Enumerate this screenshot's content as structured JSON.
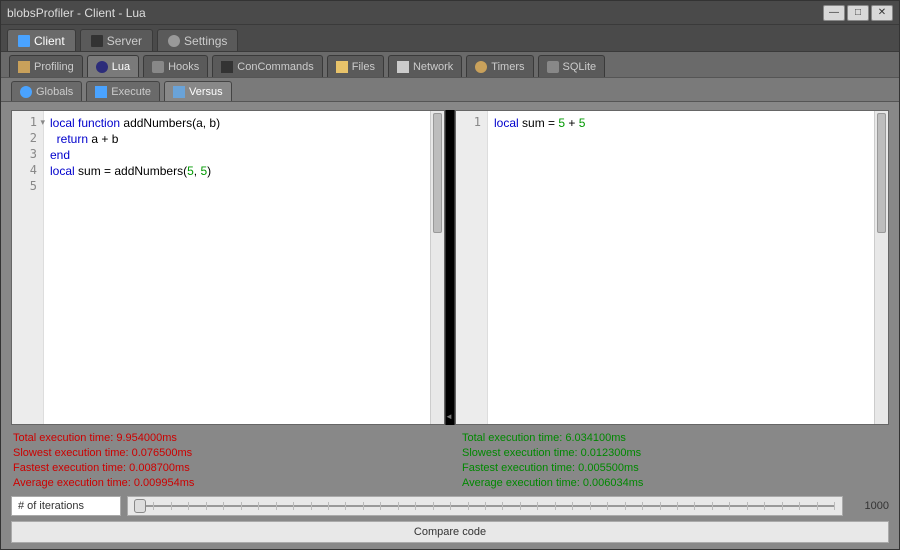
{
  "window": {
    "title": "blobsProfiler - Client - Lua"
  },
  "main_tabs": [
    {
      "label": "Client",
      "active": true
    },
    {
      "label": "Server",
      "active": false
    },
    {
      "label": "Settings",
      "active": false
    }
  ],
  "sub_tabs": [
    {
      "label": "Profiling",
      "active": false
    },
    {
      "label": "Lua",
      "active": true
    },
    {
      "label": "Hooks",
      "active": false
    },
    {
      "label": "ConCommands",
      "active": false
    },
    {
      "label": "Files",
      "active": false
    },
    {
      "label": "Network",
      "active": false
    },
    {
      "label": "Timers",
      "active": false
    },
    {
      "label": "SQLite",
      "active": false
    }
  ],
  "tert_tabs": [
    {
      "label": "Globals",
      "active": false
    },
    {
      "label": "Execute",
      "active": false
    },
    {
      "label": "Versus",
      "active": true
    }
  ],
  "left_code": {
    "lines": [
      "1",
      "2",
      "3",
      "4",
      "5"
    ],
    "tokens": [
      [
        {
          "t": "local",
          "c": "kw"
        },
        {
          "t": " "
        },
        {
          "t": "function",
          "c": "kw"
        },
        {
          "t": " addNumbers(a, b)"
        }
      ],
      [
        {
          "t": "  "
        },
        {
          "t": "return",
          "c": "kw"
        },
        {
          "t": " a + b"
        }
      ],
      [
        {
          "t": "end",
          "c": "kw"
        }
      ],
      [
        {
          "t": ""
        }
      ],
      [
        {
          "t": "local",
          "c": "kw"
        },
        {
          "t": " sum = addNumbers("
        },
        {
          "t": "5",
          "c": "num"
        },
        {
          "t": ", "
        },
        {
          "t": "5",
          "c": "num"
        },
        {
          "t": ")"
        }
      ]
    ]
  },
  "right_code": {
    "lines": [
      "1"
    ],
    "tokens": [
      [
        {
          "t": "local",
          "c": "kw"
        },
        {
          "t": " sum = "
        },
        {
          "t": "5",
          "c": "num"
        },
        {
          "t": " + "
        },
        {
          "t": "5",
          "c": "num"
        }
      ]
    ]
  },
  "stats_left": {
    "total": "Total execution time: 9.954000ms",
    "slowest": "Slowest execution time: 0.076500ms",
    "fastest": "Fastest execution time: 0.008700ms",
    "average": "Average execution time: 0.009954ms"
  },
  "stats_right": {
    "total": "Total execution time: 6.034100ms",
    "slowest": "Slowest execution time: 0.012300ms",
    "fastest": "Fastest execution time: 0.005500ms",
    "average": "Average execution time: 0.006034ms"
  },
  "iterations": {
    "label": "# of iterations",
    "max": "1000"
  },
  "compare_button": "Compare code"
}
